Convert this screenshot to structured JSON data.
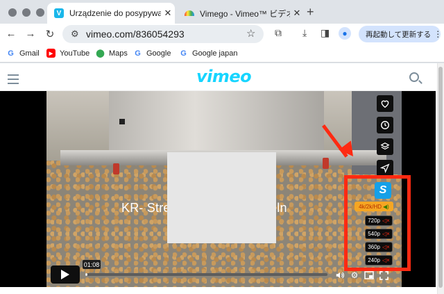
{
  "browser": {
    "tabs": [
      {
        "title": "Urządzenie do posypywania",
        "favicon": "V",
        "favicon_color": "#1ab7ea",
        "active": true
      },
      {
        "title": "Vimego - Vimeo™ ビデオダウ",
        "favicon": "rainbow",
        "active": false
      }
    ],
    "url": "vimeo.com/836054293",
    "relaunch_label": "再起動して更新する",
    "bookmarks": [
      {
        "label": "Gmail",
        "icon": "google-icon"
      },
      {
        "label": "YouTube",
        "icon": "youtube-icon"
      },
      {
        "label": "Maps",
        "icon": "maps-icon"
      },
      {
        "label": "Google",
        "icon": "google-icon"
      },
      {
        "label": "Google japan",
        "icon": "google-icon"
      }
    ]
  },
  "site": {
    "logo": "vimeo"
  },
  "video": {
    "overlay_text": "KR- Streuer für Röstzwiebeln",
    "current_time": "01:08",
    "progress": 0.01
  },
  "extension": {
    "logo_letter": "S",
    "hd_label": "4k/2k/HD",
    "resolutions": [
      "720p",
      "540p",
      "360p",
      "240p"
    ]
  },
  "colors": {
    "accent": "#17d5ff",
    "highlight": "#ff2a12",
    "hd_button": "#f5a623"
  }
}
